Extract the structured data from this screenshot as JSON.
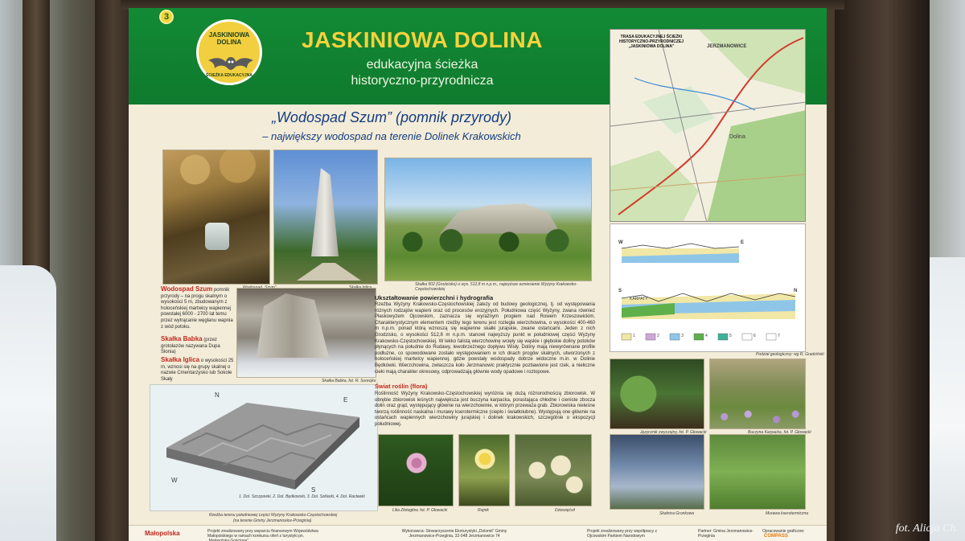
{
  "board": {
    "stop_number": "3",
    "logo": {
      "top_text": "JASKINIOWA DOLINA",
      "bottom_text": "ŚCIEŻKA EDUKACYJNA"
    },
    "title": "JASKINIOWA DOLINA",
    "subtitle_line1": "edukacyjna ścieżka",
    "subtitle_line2": "historyczno-przyrodnicza",
    "section_title": "„Wodospad Szum” (pomnik przyrody)",
    "section_subtitle": "– największy wodospad na terenie Dolinek Krakowskich"
  },
  "captions": {
    "waterfall": "Wodospad „Szum”",
    "rock": "Skałka Iglica",
    "hill": "Skałka 502 (Grodzisko) o wys. 512,8 m n.p.m., najwyższe wzniesienie Wyżyny Krakowsko-Częstochowskiej",
    "gorge": "Skałka Babka, fot. R. Surecjko",
    "relief_line1": "1. Dol. Szczpowki, 2. Dol. Będkowski, 3. Dol. Szklarki, 4. Dol. Racławki",
    "relief_line2": "Rzeźba terenu południowej części Wyżyny Krakowsko-Częstochowskiej",
    "relief_line3": "(na terenie Gminy Jerzmanowice-Przeginia)",
    "profiles": "Podział geologiczny: wg R. Gradziński",
    "fern": "Języcznik zwyczajny, fot. P. Głowacki",
    "beech": "Buczyna Karpacka, fot. P. Głowacki",
    "sedge": "Skalnica Gronkowa",
    "meadow": "Murawa kserotermiczna",
    "flower1": "Lilia Złotogłów, fot. P. Głowacki",
    "flower2": "Rojnik",
    "flower3": "Dziewięćsił"
  },
  "texts": {
    "waterfall_name": "Wodospad Szum",
    "waterfall_body": "pomnik przyrody – na progu skalnym o wysokości 5 m, zbudowanym z holoceńskiej martwicy wapiennej powstałej 6000 - 2700 lat temu przez wytrącanie węglanu wapnia z wód potoku.",
    "babka_name": "Skałka Babka",
    "babka_body": "(przez grotołazów nazywana Dupa Słonia)",
    "iglica_name": "Skałka Iglica",
    "iglica_body": "o wysokości 25 m, wznosi się na grupy skalnej o nazwie Cmentarzysko lub Sokole Skały",
    "geo_head": "Ukształtowanie powierzchni i hydrografia",
    "geo_body": "Rzeźba Wyżyny Krakowsko-Częstochowskiej zależy od budowy geologicznej, tj. od występowania różnych rodzajów wapieni oraz od procesów erozyjnych. Południowa część Wyżyny, zwana również Płaskowyżem Ojcowskim, zaznacza się wyraźnym progiem nad Rowem Krzeszowickim. Charakterystycznym elementem rzeźby tego terenu jest rozległa wierzchowina, o wysokości 400-460 m n.p.m. ponad którą wznoszą się wapienne skałki jurajskie, zwane ostańcami. Jeden z nich Grodzisko, o wysokości 512,8 m n.p.m. stanowi najwyższy punkt w południowej części Wyżyny Krakowsko-Częstochowskiej. W lekko falistą wierzchowinę wcięły się wąskie i głębokie doliny potoków płynących na południe do Rudawy, lewobrzeżnego dopływu Wisły. Doliny mają niewyrównane profile podłużne, co spowodowane zostało występowaniem w ich dnach progów skalnych, utworzonych z holoceńskiej martwicy wapiennej, gdzie powstały wodospady dobrze widoczne m.in. w Dolinie Będkówki. Wierzchowina, zwłaszcza koło Jerzmanowic praktycznie pozbawione jest rzek, a nieliczne cieki mają charakter okresowy, odprowadzają głównie wody opadowe i roztopowe.",
    "flora_head": "Świat roślin (flora)",
    "flora_body": "Roślinność Wyżyny Krakowsko-Częstochowskiej wyróżnia się dużą różnorodnością zbiorowisk. W obrębie zbiorowisk leśnych największa jest buczyna karpacka, porastająca chłodne i cieniste zbocza dolin oraz grąd, występujący głównie na wierzchowinie, w którym przeważa grab. Zbiorowiska nieleśne tworzą roślinność naskalna i murawy kserotermiczne (ciepło i światłolubne). Występują one głównie na ostańcach wapiennych wierzchowiny jurajskiej i dolinek krakowskich, szczególnie o ekspozycji południowej."
  },
  "map": {
    "title": "TRASA EDUKACYJNEJ ŚCIEŻKI HISTORYCZNO-PRZYRODNICZEJ „JASKINIOWA DOLINA”",
    "place_top": "JERZMANOWICE",
    "place_mid": "Dolina"
  },
  "profiles": {
    "top_left": "W",
    "top_right": "E",
    "bottom_left": "S",
    "bottom_right": "N",
    "label_karpaty": "KARPATY",
    "legend": [
      "1",
      "2",
      "3",
      "4",
      "5",
      "6",
      "7"
    ]
  },
  "relief_compass": {
    "n": "N",
    "e": "E",
    "s": "S",
    "w": "W"
  },
  "footer": {
    "malopolska": "Małopolska",
    "item1": "Projekt zrealizowany przy wsparciu finansowym Województwa Małopolskiego w ramach konkursu ofert z turystyki pn. „Małopolska Gościnna”",
    "item2": "Wykonawca: Stowarzyszenie Ekoturystyki „Dolomit” Gminy Jerzmanowice-Przeginia, 32-048 Jerzmanowice 74",
    "item3": "Projekt zrealizowany przy współpracy z Ojcowskim Parkiem Narodowym",
    "item4": "Partner: Gmina Jerzmanowice-Przeginia",
    "item5": "Opracowanie graficzne:",
    "compass": "COMPASS"
  },
  "watermark": "fot. Alicja Ch."
}
